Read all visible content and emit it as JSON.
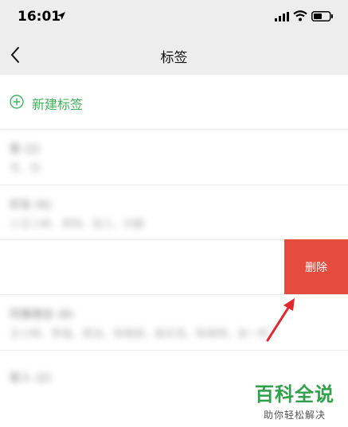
{
  "status_bar": {
    "time": "16:01"
  },
  "nav": {
    "title": "标签"
  },
  "new_tag": {
    "label": "新建标签"
  },
  "tag_rows": [
    {
      "name": "客 (2)",
      "members": "号、你"
    },
    {
      "name": "好友 (6)",
      "members": "小王小林、李四、张三、刘路"
    },
    {
      "name": "",
      "members": ""
    },
    {
      "name": "同事朋友 (8)",
      "members": "王小明、李强、周洁、宋晓丽、胡文浩、陈晓明、张一鸣…"
    },
    {
      "name": "家人 (2)",
      "members": ""
    }
  ],
  "actions": {
    "delete_label": "删除"
  },
  "watermark": {
    "title": "百科全说",
    "subtitle": "助你轻松解决"
  },
  "colors": {
    "accent": "#3fb659",
    "danger": "#e64c3e",
    "arrow": "#e3262b"
  }
}
